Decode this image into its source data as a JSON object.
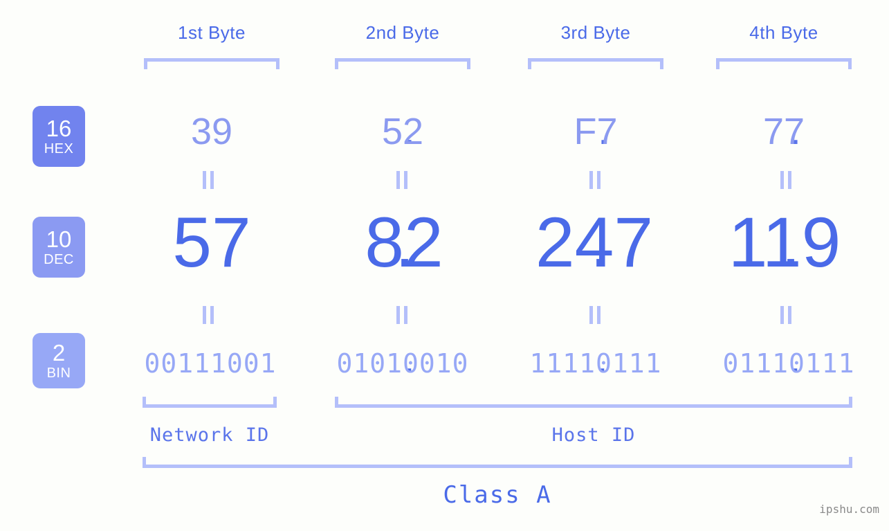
{
  "colors": {
    "background": "#fdfefb",
    "accent_strong": "#4a6ae8",
    "accent_mid": "#8b9af0",
    "accent_light": "#97a8f6",
    "bracket": "#b4bffa",
    "badge_hex": "#7183ee",
    "badge_dec": "#8b9af2",
    "badge_bin": "#97a8f6",
    "watermark": "#8a8a8a"
  },
  "headers": [
    {
      "label": "1st Byte"
    },
    {
      "label": "2nd Byte"
    },
    {
      "label": "3rd Byte"
    },
    {
      "label": "4th Byte"
    }
  ],
  "radix_badges": [
    {
      "number": "16",
      "abbr": "HEX"
    },
    {
      "number": "10",
      "abbr": "DEC"
    },
    {
      "number": "2",
      "abbr": "BIN"
    }
  ],
  "separator": ".",
  "equals_mark": "=",
  "rows": {
    "hex": {
      "radix": "16",
      "name": "HEX",
      "values": [
        "39",
        "52",
        "F7",
        "77"
      ]
    },
    "dec": {
      "radix": "10",
      "name": "DEC",
      "values": [
        "57",
        "82",
        "247",
        "119"
      ]
    },
    "bin": {
      "radix": "2",
      "name": "BIN",
      "values": [
        "00111001",
        "01010010",
        "11110111",
        "01110111"
      ]
    }
  },
  "id_spans": {
    "network": {
      "label": "Network ID"
    },
    "host": {
      "label": "Host ID"
    }
  },
  "class_span": {
    "label": "Class A"
  },
  "watermark": "ipshu.com"
}
